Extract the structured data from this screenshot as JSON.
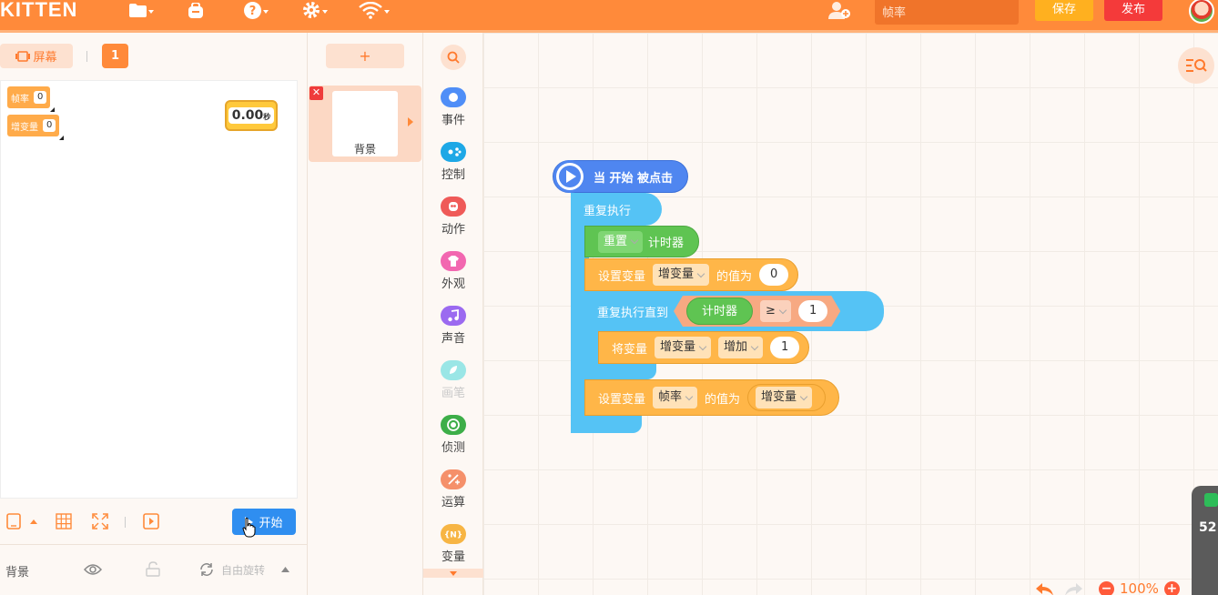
{
  "app": {
    "logo": "KITTEN"
  },
  "topbar": {
    "search_placeholder": "帧率",
    "save_label": "保存",
    "publish_label": "发布",
    "icons": [
      "folder-icon",
      "backpack-icon",
      "help-icon",
      "gear-icon",
      "wifi-icon",
      "add-user-icon"
    ]
  },
  "stage_panel": {
    "screen_label": "屏幕",
    "scene_number": "1",
    "monitors": [
      {
        "name": "帧率",
        "value": "0"
      },
      {
        "name": "增变量",
        "value": "0"
      }
    ],
    "timer": {
      "value": "0.00",
      "unit": "秒"
    },
    "start_label": "开始",
    "sprite_name": "背景",
    "rotation_label": "自由旋转"
  },
  "backdrops": {
    "add_label": "+",
    "items": [
      {
        "name": "背景"
      }
    ]
  },
  "categories": [
    {
      "label": "事件",
      "color": "#4f8ef7",
      "icon": "event-icon"
    },
    {
      "label": "控制",
      "color": "#1ea8e6",
      "icon": "control-icon"
    },
    {
      "label": "动作",
      "color": "#ef5a58",
      "icon": "motion-icon"
    },
    {
      "label": "外观",
      "color": "#f267b0",
      "icon": "looks-icon"
    },
    {
      "label": "声音",
      "color": "#9b6af0",
      "icon": "sound-icon"
    },
    {
      "label": "画笔",
      "color": "#9ae6e6",
      "icon": "pen-icon",
      "dim": true
    },
    {
      "label": "侦测",
      "color": "#3dae48",
      "icon": "sensing-icon"
    },
    {
      "label": "运算",
      "color": "#f5906a",
      "icon": "operator-icon"
    },
    {
      "label": "变量",
      "color": "#f7b544",
      "icon": "variable-icon"
    }
  ],
  "script": {
    "hat": "当 开始 被点击",
    "forever": "重复执行",
    "reset": {
      "dropdown": "重置",
      "text": "计时器"
    },
    "set1": {
      "prefix": "设置变量",
      "var": "增变量",
      "mid": "的值为",
      "value": "0"
    },
    "repeat_until": {
      "prefix": "重复执行直到",
      "left": "计时器",
      "op": "≥",
      "right": "1"
    },
    "change": {
      "prefix": "将变量",
      "var": "增变量",
      "op": "增加",
      "value": "1"
    },
    "set2": {
      "prefix": "设置变量",
      "var": "帧率",
      "mid": "的值为",
      "value": "增变量"
    }
  },
  "canvas": {
    "zoom": "100%"
  },
  "widget": {
    "value": "52"
  }
}
